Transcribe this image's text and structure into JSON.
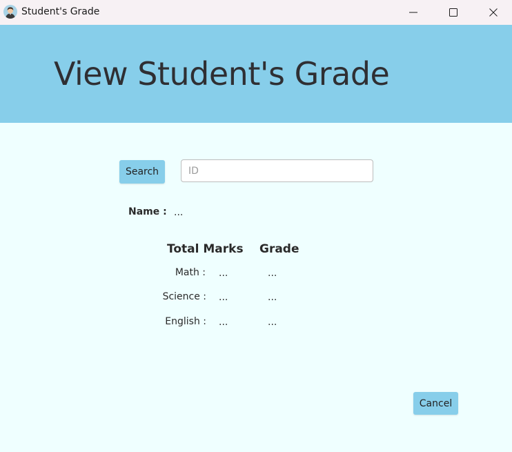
{
  "window": {
    "title": "Student's Grade",
    "app_icon": "student-avatar-icon",
    "controls": [
      "minimize-icon",
      "maximize-icon",
      "close-icon"
    ]
  },
  "header": {
    "title": "View Student's Grade",
    "background_color": "#87ceea"
  },
  "search": {
    "button_label": "Search",
    "input_value": "",
    "input_placeholder": "ID"
  },
  "student": {
    "name_label": "Name :",
    "name_value": "..."
  },
  "results": {
    "headers": {
      "marks": "Total Marks",
      "grade": "Grade"
    },
    "rows": [
      {
        "subject": "Math :",
        "marks": "...",
        "grade": "..."
      },
      {
        "subject": "Science :",
        "marks": "...",
        "grade": "..."
      },
      {
        "subject": "English :",
        "marks": "...",
        "grade": "..."
      }
    ]
  },
  "footer": {
    "cancel_label": "Cancel"
  },
  "colors": {
    "accent": "#87ceea",
    "background": "#efffff",
    "titlebar": "#f7f1f4"
  }
}
